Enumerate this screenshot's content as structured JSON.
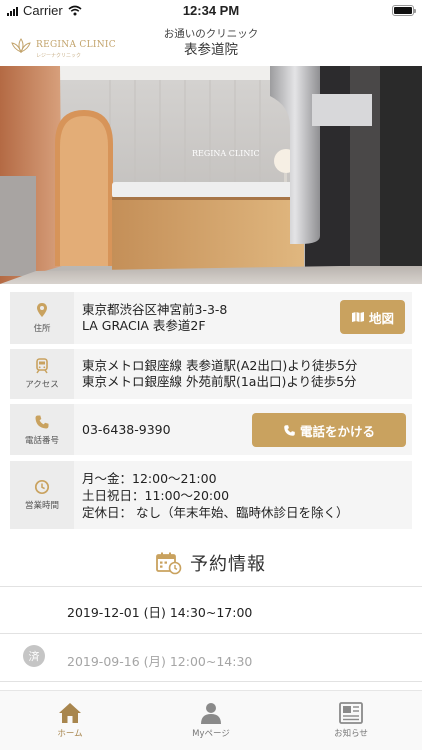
{
  "status_bar": {
    "carrier": "Carrier",
    "time": "12:34 PM"
  },
  "header": {
    "logo_text": "REGINA CLINIC",
    "logo_subtext": "レジーナクリニック",
    "subtitle": "お通いのクリニック",
    "title": "表参道院"
  },
  "hero": {
    "sign_text": "REGINA CLINIC"
  },
  "info": {
    "address": {
      "label": "住所",
      "icon": "map-pin-icon",
      "line1": "東京都渋谷区神宮前3-3-8",
      "line2": "LA GRACIA 表参道2F",
      "button": "地図"
    },
    "access": {
      "label": "アクセス",
      "icon": "train-icon",
      "line1": "東京メトロ銀座線 表参道駅(A2出口)より徒歩5分",
      "line2": "東京メトロ銀座線 外苑前駅(1a出口)より徒歩5分"
    },
    "phone": {
      "label": "電話番号",
      "icon": "phone-icon",
      "number": "03-6438-9390",
      "button": "電話をかける"
    },
    "hours": {
      "label": "営業時間",
      "icon": "clock-icon",
      "line1": "月～金：12:00～21:00",
      "line2": "土日祝日：11:00～20:00",
      "line3": "定休日：  なし（年末年始、臨時休診日を除く）"
    }
  },
  "reservation": {
    "title": "予約情報",
    "items": [
      {
        "date": "2019-12-01 (日) 14:30~17:00",
        "done": false
      },
      {
        "date": "2019-09-16 (月) 12:00~14:30",
        "done": true,
        "badge": "済"
      }
    ]
  },
  "tabs": [
    {
      "label": "ホーム",
      "icon": "home-icon",
      "active": true
    },
    {
      "label": "Myページ",
      "icon": "user-icon",
      "active": false
    },
    {
      "label": "お知らせ",
      "icon": "news-icon",
      "active": false
    }
  ],
  "colors": {
    "accent": "#c9a25f",
    "active_tab": "#a8864e",
    "inactive_tab": "#777777"
  }
}
